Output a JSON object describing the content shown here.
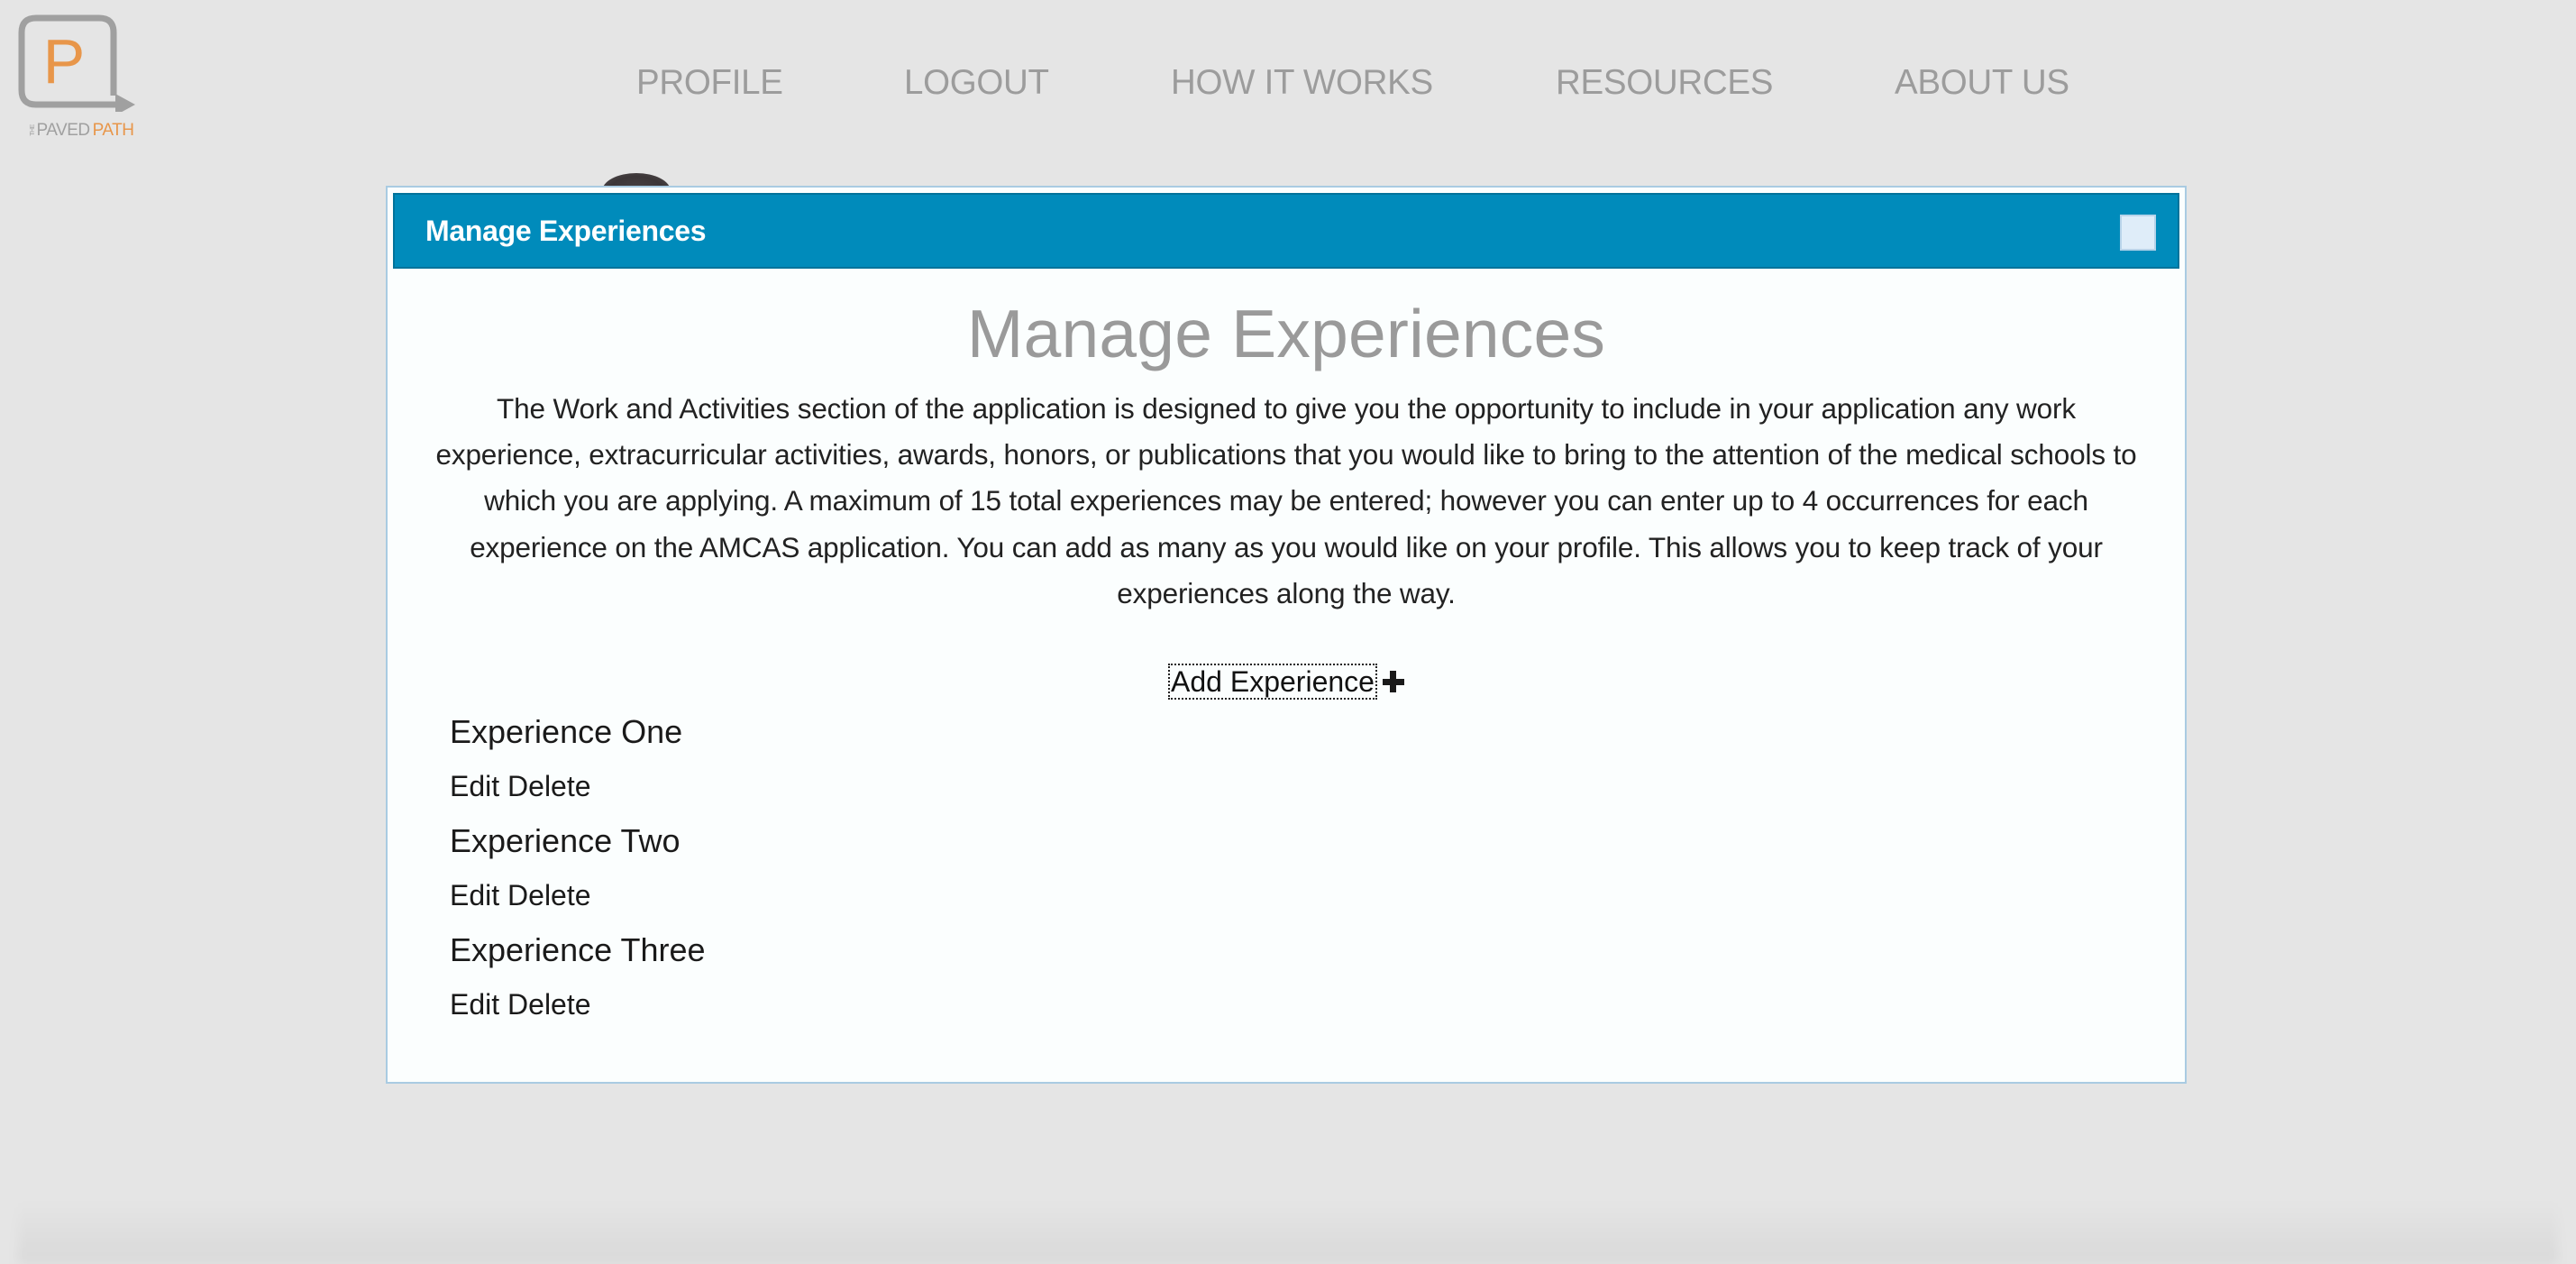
{
  "logo": {
    "letter": "P",
    "text_the": "THE",
    "text_paved": "PAVED",
    "text_path": "PATH",
    "colors": {
      "orange": "#e8964a",
      "grey": "#a0a0a0"
    }
  },
  "nav": {
    "items": [
      {
        "label": "PROFILE"
      },
      {
        "label": "LOGOUT"
      },
      {
        "label": "HOW IT WORKS"
      },
      {
        "label": "RESOURCES"
      },
      {
        "label": "ABOUT US"
      }
    ]
  },
  "dialog": {
    "title": "Manage Experiences",
    "close_icon": "close-square-icon",
    "heading": "Manage Experiences",
    "description": "The Work and Activities section of the application is designed to give you the opportunity to include in your application any work experience, extracurricular activities, awards, honors, or publications that you would like to bring to the attention of the medical schools to which you are applying. A maximum of 15 total experiences may be entered; however you can enter up to 4 occurrences for each experience on the AMCAS application. You can add as many as you would like on your profile. This allows you to keep track of your experiences along the way.",
    "add_button_label": "Add Experience",
    "add_icon": "plus-icon",
    "colors": {
      "titlebar": "#008bbb",
      "border": "#a9cbe2"
    },
    "experiences": [
      {
        "title": "Experience One",
        "edit_label": "Edit",
        "delete_label": "Delete"
      },
      {
        "title": "Experience Two",
        "edit_label": "Edit",
        "delete_label": "Delete"
      },
      {
        "title": "Experience Three",
        "edit_label": "Edit",
        "delete_label": "Delete"
      }
    ]
  }
}
